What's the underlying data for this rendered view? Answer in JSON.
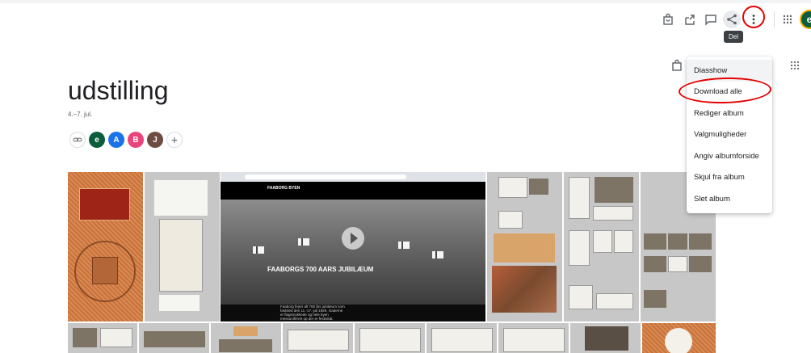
{
  "toolbar": {
    "icons": [
      "shopping-bag-icon",
      "upload-icon",
      "comment-icon",
      "share-icon",
      "more-vert-icon",
      "apps-grid-icon"
    ],
    "avatar_letter": "e",
    "tooltip": "Del"
  },
  "album": {
    "title": "udstilling",
    "date": "4.–7. jul."
  },
  "sharing": {
    "members": [
      {
        "letter": "e",
        "color": "#0b5d3b"
      },
      {
        "letter": "A",
        "color": "#1a73e8"
      },
      {
        "letter": "B",
        "color": "#e8457c"
      },
      {
        "letter": "J",
        "color": "#6d4c41"
      }
    ],
    "add_symbol": "+"
  },
  "menu": {
    "items": [
      "Diasshow",
      "Download alle",
      "Rediger album",
      "Valgmuligheder",
      "Angiv albumforside",
      "Skjul fra album",
      "Slet album"
    ]
  },
  "screenshot_photo": {
    "hero_title": "FAABORGS 700 AARS JUBILÆUM",
    "logo": "FAABORG BYEN",
    "footer_text": "Faaborg fejrer alt 700 års jubilæum som fastsled den 11.-17. juli 1929. Gaderne er flagsmykkede og hele byen messuniferret op der er festivität."
  },
  "colors": {
    "annotation_red": "#e50000",
    "menu_hover": "#f1f3f4"
  }
}
